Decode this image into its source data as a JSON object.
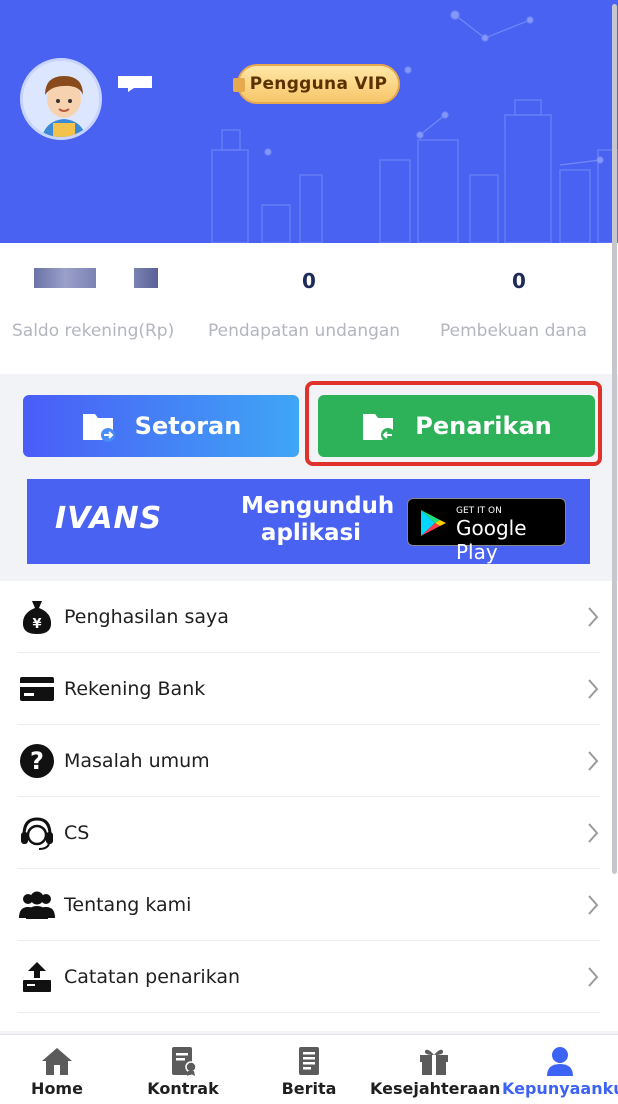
{
  "header": {
    "vip_label": "Pengguna VIP",
    "bg_color": "#4a62f2"
  },
  "stats": [
    {
      "value": "",
      "label": "Saldo rekening(Rp)"
    },
    {
      "value": "0",
      "label": "Pendapatan undangan"
    },
    {
      "value": "0",
      "label": "Pembekuan dana"
    }
  ],
  "actions": {
    "setoran_label": "Setoran",
    "penarikan_label": "Penarikan"
  },
  "banner": {
    "brand": "IVANS",
    "text": "Mengunduh aplikasi",
    "store_small": "GET IT ON",
    "store_big": "Google Play"
  },
  "menu": {
    "items": [
      {
        "label": "Penghasilan saya",
        "icon": "money-bag-icon"
      },
      {
        "label": "Rekening Bank",
        "icon": "card-icon"
      },
      {
        "label": "Masalah umum",
        "icon": "question-icon"
      },
      {
        "label": "CS",
        "icon": "headset-icon"
      },
      {
        "label": "Tentang kami",
        "icon": "users-icon"
      },
      {
        "label": "Catatan penarikan",
        "icon": "upload-tray-icon"
      }
    ]
  },
  "nav": {
    "items": [
      {
        "label": "Home",
        "icon": "home-icon"
      },
      {
        "label": "Kontrak",
        "icon": "contract-icon"
      },
      {
        "label": "Berita",
        "icon": "news-icon"
      },
      {
        "label": "Kesejahteraan",
        "icon": "gift-icon"
      },
      {
        "label": "Kepunyaanku",
        "icon": "user-icon"
      }
    ],
    "active_color": "#3d63f5"
  }
}
